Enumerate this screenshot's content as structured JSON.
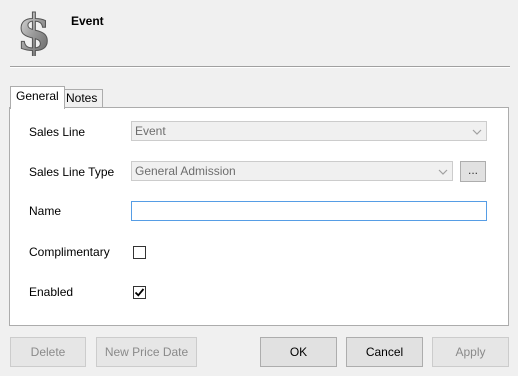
{
  "header": {
    "title": "Event"
  },
  "tabs": [
    {
      "label": "General",
      "selected": true
    },
    {
      "label": "Notes",
      "selected": false
    }
  ],
  "form": {
    "sales_line": {
      "label": "Sales Line",
      "value": "Event",
      "enabled": false
    },
    "sales_line_type": {
      "label": "Sales Line Type",
      "value": "General Admission",
      "enabled": false,
      "browse_label": "..."
    },
    "name": {
      "label": "Name",
      "value": ""
    },
    "complimentary": {
      "label": "Complimentary",
      "checked": false
    },
    "enabled": {
      "label": "Enabled",
      "checked": true
    }
  },
  "buttons": {
    "delete": {
      "label": "Delete",
      "enabled": false
    },
    "new_price_date": {
      "label": "New Price Date",
      "enabled": false
    },
    "ok": {
      "label": "OK",
      "enabled": true
    },
    "cancel": {
      "label": "Cancel",
      "enabled": true
    },
    "apply": {
      "label": "Apply",
      "enabled": false
    }
  },
  "colors": {
    "window_bg": "#f0f0f0",
    "panel_bg": "#ffffff",
    "focus_border": "#569de5",
    "disabled_text": "#8a8a8a"
  },
  "icons": {
    "header": "dollar-sign-icon"
  }
}
